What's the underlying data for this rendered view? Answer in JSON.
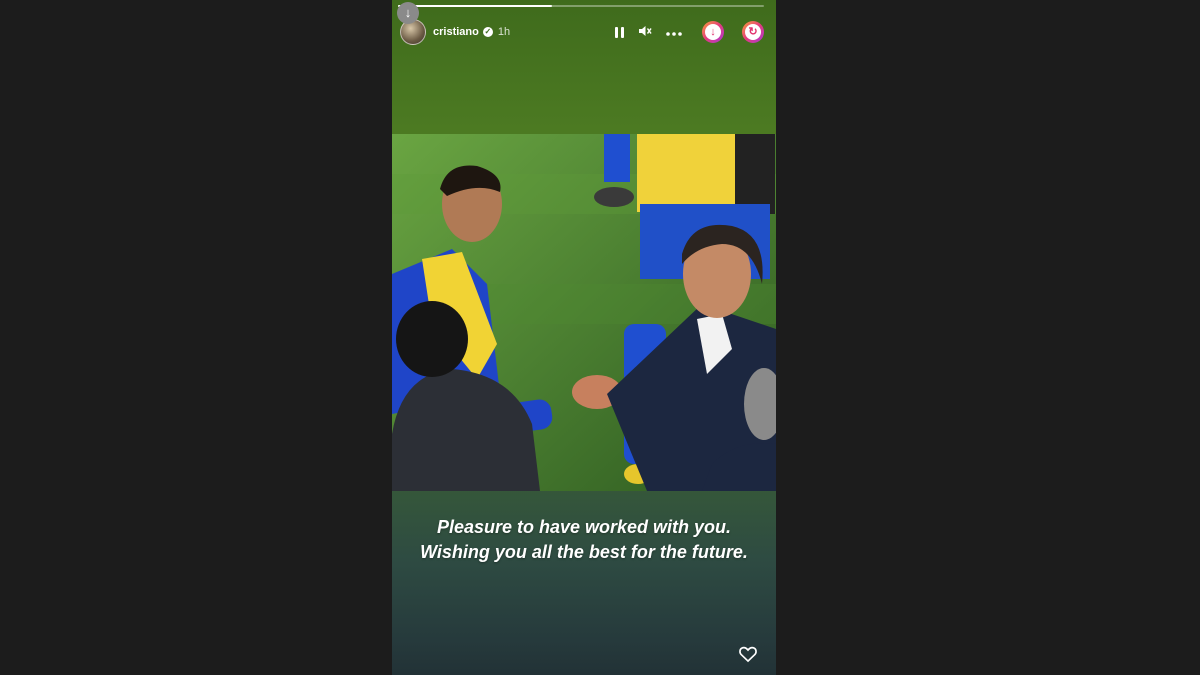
{
  "story": {
    "progress": 0.42,
    "username": "cristiano",
    "time": "1h",
    "icons": {
      "download": "download-icon",
      "verified": "verified-badge-icon",
      "pause": "pause-icon",
      "mute": "mute-icon",
      "more": "more-icon",
      "save": "save-icon",
      "repost": "repost-icon",
      "heart": "heart-icon"
    },
    "caption": {
      "line1": "Pleasure to have worked with you.",
      "line2": "Wishing you all the best for the future."
    },
    "colors": {
      "accent": "#e1306c",
      "background_top": "#4c7a22",
      "background_bottom": "#223236"
    }
  }
}
